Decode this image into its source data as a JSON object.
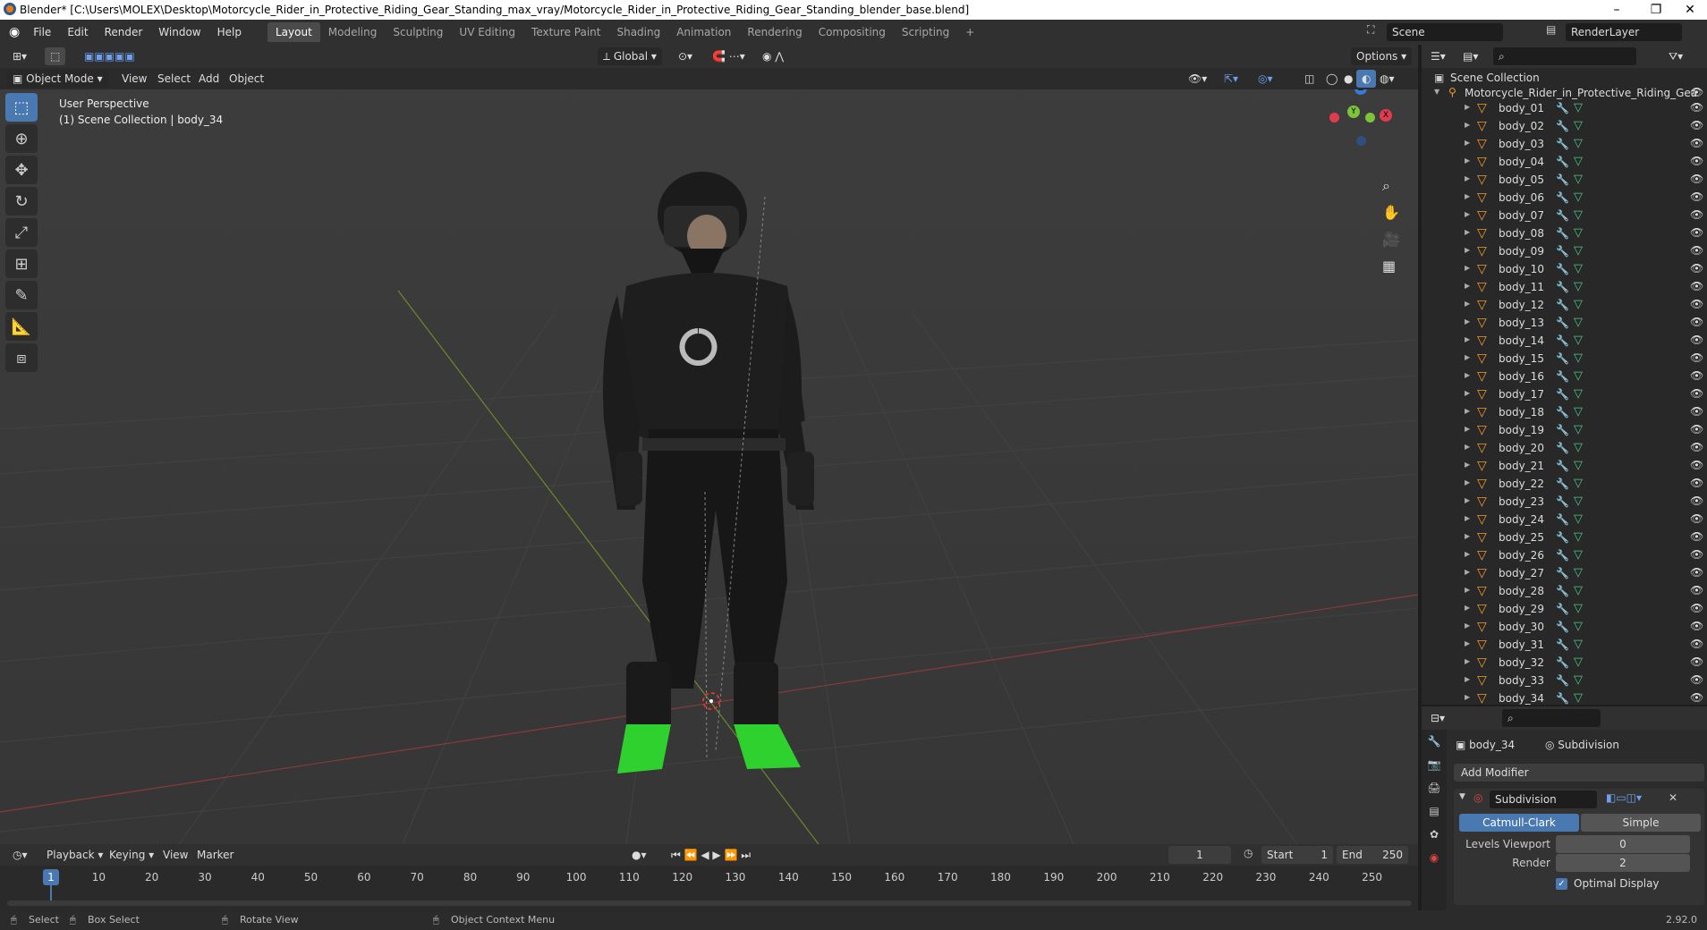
{
  "window": {
    "title": "Blender* [C:\\Users\\MOLEX\\Desktop\\Motorcycle_Rider_in_Protective_Riding_Gear_Standing_max_vray/Motorcycle_Rider_in_Protective_Riding_Gear_Standing_blender_base.blend]",
    "minimize": "–",
    "maximize": "❐",
    "close": "✕"
  },
  "menu": [
    "File",
    "Edit",
    "Render",
    "Window",
    "Help"
  ],
  "workspaces": [
    "Layout",
    "Modeling",
    "Sculpting",
    "UV Editing",
    "Texture Paint",
    "Shading",
    "Animation",
    "Rendering",
    "Compositing",
    "Scripting",
    "+"
  ],
  "active_workspace": "Layout",
  "scene": {
    "name": "Scene",
    "render_layer": "RenderLayer"
  },
  "viewport": {
    "transform_orientation": "Global",
    "options": "Options",
    "mode": "Object Mode",
    "header_menus": [
      "View",
      "Select",
      "Add",
      "Object"
    ],
    "perspective_label": "User Perspective",
    "collection_label": "(1) Scene Collection | body_34",
    "gizmo_axes": {
      "x": "X",
      "y": "Y",
      "z": "Z"
    }
  },
  "outliner": {
    "root": "Scene Collection",
    "collection": "Motorcycle_Rider_in_Protective_Riding_Gea",
    "items": [
      "body_01",
      "body_02",
      "body_03",
      "body_04",
      "body_05",
      "body_06",
      "body_07",
      "body_08",
      "body_09",
      "body_10",
      "body_11",
      "body_12",
      "body_13",
      "body_14",
      "body_15",
      "body_16",
      "body_17",
      "body_18",
      "body_19",
      "body_20",
      "body_21",
      "body_22",
      "body_23",
      "body_24",
      "body_25",
      "body_26",
      "body_27",
      "body_28",
      "body_29",
      "body_30",
      "body_31",
      "body_32",
      "body_33",
      "body_34"
    ]
  },
  "properties": {
    "object": "body_34",
    "modifier_tab": "Subdivision",
    "add_modifier": "Add Modifier",
    "modifier_name": "Subdivision",
    "catmull": "Catmull-Clark",
    "simple": "Simple",
    "levels_viewport_label": "Levels Viewport",
    "levels_viewport": "0",
    "render_label": "Render",
    "render_level": "2",
    "optimal_display": "Optimal Display"
  },
  "timeline": {
    "menus": [
      "Playback",
      "Keying",
      "View",
      "Marker"
    ],
    "current_frame": "1",
    "start_label": "Start",
    "start": "1",
    "end_label": "End",
    "end": "250",
    "ticks": [
      "1",
      "10",
      "20",
      "30",
      "40",
      "50",
      "60",
      "70",
      "80",
      "90",
      "100",
      "110",
      "120",
      "130",
      "140",
      "150",
      "160",
      "170",
      "180",
      "190",
      "200",
      "210",
      "220",
      "230",
      "240",
      "250"
    ]
  },
  "statusbar": {
    "select": "Select",
    "box_select": "Box Select",
    "rotate": "Rotate View",
    "context": "Object Context Menu",
    "version": "2.92.0"
  }
}
